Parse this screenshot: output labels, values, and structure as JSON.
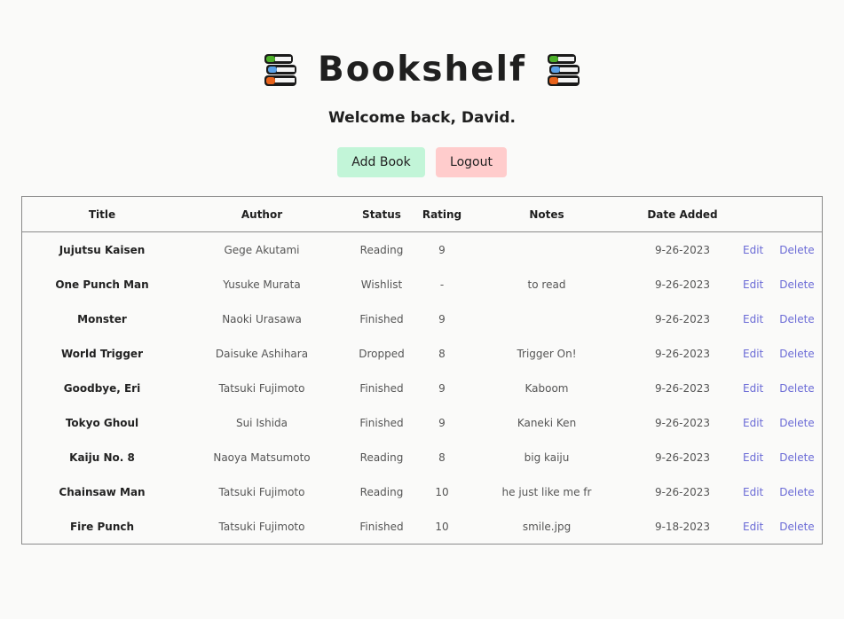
{
  "header": {
    "title": "Bookshelf",
    "left_icon": "books-icon",
    "right_icon": "books-icon"
  },
  "welcome": "Welcome back, David.",
  "actions": {
    "add_label": "Add Book",
    "logout_label": "Logout"
  },
  "table": {
    "columns": [
      "Title",
      "Author",
      "Status",
      "Rating",
      "Notes",
      "Date Added"
    ],
    "edit_label": "Edit",
    "delete_label": "Delete",
    "rows": [
      {
        "title": "Jujutsu Kaisen",
        "author": "Gege Akutami",
        "status": "Reading",
        "rating": "9",
        "notes": "",
        "date": "9-26-2023"
      },
      {
        "title": "One Punch Man",
        "author": "Yusuke Murata",
        "status": "Wishlist",
        "rating": "-",
        "notes": "to read",
        "date": "9-26-2023"
      },
      {
        "title": "Monster",
        "author": "Naoki Urasawa",
        "status": "Finished",
        "rating": "9",
        "notes": "",
        "date": "9-26-2023"
      },
      {
        "title": "World Trigger",
        "author": "Daisuke Ashihara",
        "status": "Dropped",
        "rating": "8",
        "notes": "Trigger On!",
        "date": "9-26-2023"
      },
      {
        "title": "Goodbye, Eri",
        "author": "Tatsuki Fujimoto",
        "status": "Finished",
        "rating": "9",
        "notes": "Kaboom",
        "date": "9-26-2023"
      },
      {
        "title": "Tokyo Ghoul",
        "author": "Sui Ishida",
        "status": "Finished",
        "rating": "9",
        "notes": "Kaneki Ken",
        "date": "9-26-2023"
      },
      {
        "title": "Kaiju No. 8",
        "author": "Naoya Matsumoto",
        "status": "Reading",
        "rating": "8",
        "notes": "big kaiju",
        "date": "9-26-2023"
      },
      {
        "title": "Chainsaw Man",
        "author": "Tatsuki Fujimoto",
        "status": "Reading",
        "rating": "10",
        "notes": "he just like me fr",
        "date": "9-26-2023"
      },
      {
        "title": "Fire Punch",
        "author": "Tatsuki Fujimoto",
        "status": "Finished",
        "rating": "10",
        "notes": "smile.jpg",
        "date": "9-18-2023"
      }
    ]
  },
  "colors": {
    "background": "#fafaf9",
    "add_button": "#c2f5d8",
    "logout_button": "#ffcccc",
    "link": "#6b6bd6"
  }
}
